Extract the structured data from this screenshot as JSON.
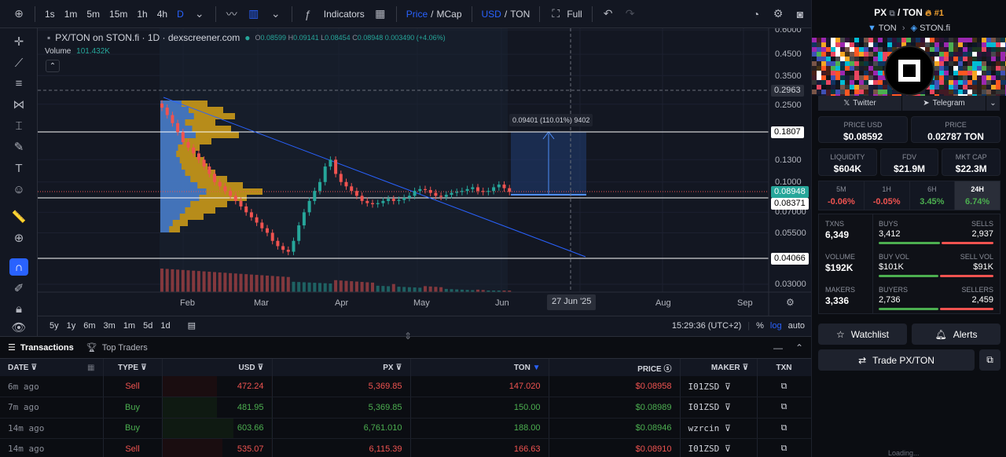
{
  "toolbar": {
    "timeframes": [
      "1s",
      "1m",
      "5m",
      "15m",
      "1h",
      "4h",
      "D"
    ],
    "active_timeframe": "D",
    "indicators_label": "Indicators",
    "price_label": "Price",
    "mcap_label": "MCap",
    "usd_label": "USD",
    "ton_label": "TON",
    "full_label": "Full"
  },
  "chart": {
    "pair_title": "PX/TON on STON.fi · 1D · dexscreener.com",
    "ohlc": {
      "o": "0.08599",
      "h": "0.09141",
      "l": "0.08454",
      "c": "0.08948",
      "change": "0.003490 (+4.06%)"
    },
    "volume_label": "Volume",
    "volume_value": "101.432K",
    "y_axis_labels": [
      "0.6000",
      "0.4500",
      "0.3500",
      "0.2500",
      "0.1300",
      "0.1000",
      "0.07000",
      "0.05500",
      "0.03000"
    ],
    "y_tags": {
      "crosshair": "0.2963",
      "line_upper": "0.1807",
      "last_price": "0.08948",
      "line_mid": "0.08371",
      "line_lower": "0.04066"
    },
    "x_axis_labels": [
      "Feb",
      "Mar",
      "Apr",
      "May",
      "Jun",
      "Aug",
      "Sep"
    ],
    "x_crosshair_tag": "27 Jun '25",
    "measure_text": "0.09401 (110.01%) 9402"
  },
  "chart_data": {
    "type": "candlestick",
    "series": [
      {
        "name": "price",
        "values": [
          0.24,
          0.22,
          0.2,
          0.18,
          0.16,
          0.15,
          0.14,
          0.13,
          0.12,
          0.11,
          0.1,
          0.095,
          0.09,
          0.085,
          0.08,
          0.075,
          0.07,
          0.066,
          0.062,
          0.058,
          0.055,
          0.05,
          0.047,
          0.045,
          0.044,
          0.05,
          0.06,
          0.07,
          0.08,
          0.09,
          0.1,
          0.12,
          0.13,
          0.11,
          0.1,
          0.095,
          0.09,
          0.085,
          0.08,
          0.078,
          0.077,
          0.078,
          0.08,
          0.082,
          0.08,
          0.081,
          0.083,
          0.085,
          0.09,
          0.092,
          0.091,
          0.088,
          0.085,
          0.084,
          0.086,
          0.088,
          0.089,
          0.09,
          0.092,
          0.094,
          0.09,
          0.089,
          0.09,
          0.094,
          0.097,
          0.093,
          0.089
        ]
      }
    ]
  },
  "bottom_bar": {
    "ranges": [
      "5y",
      "1y",
      "6m",
      "3m",
      "1m",
      "5d",
      "1d"
    ],
    "clock": "15:29:36 (UTC+2)",
    "percent_label": "%",
    "log_label": "log",
    "auto_label": "auto"
  },
  "transactions": {
    "tabs": {
      "transactions": "Transactions",
      "top_traders": "Top Traders"
    },
    "columns": [
      "DATE",
      "TYPE",
      "USD",
      "PX",
      "TON",
      "PRICE",
      "MAKER",
      "TXN"
    ],
    "rows": [
      {
        "age": "6m ago",
        "type": "Sell",
        "usd": "472.24",
        "px": "5,369.85",
        "ton": "147.020",
        "price": "$0.08958",
        "maker": "I01ZSD"
      },
      {
        "age": "7m ago",
        "type": "Buy",
        "usd": "481.95",
        "px": "5,369.85",
        "ton": "150.00",
        "price": "$0.08989",
        "maker": "I01ZSD"
      },
      {
        "age": "14m ago",
        "type": "Buy",
        "usd": "603.66",
        "px": "6,761.010",
        "ton": "188.00",
        "price": "$0.08946",
        "maker": "wzrcin"
      },
      {
        "age": "14m ago",
        "type": "Sell",
        "usd": "535.07",
        "px": "6,115.39",
        "ton": "166.63",
        "price": "$0.08910",
        "maker": "I01ZSD"
      }
    ]
  },
  "right_panel": {
    "pair": "PX",
    "quote": "TON",
    "rank": "#1",
    "chain": "TON",
    "dex": "STON.fi",
    "twitter": "Twitter",
    "telegram": "Telegram",
    "price_usd_label": "PRICE USD",
    "price_usd": "$0.08592",
    "price_label": "PRICE",
    "price_ton": "0.02787 TON",
    "liquidity_label": "LIQUIDITY",
    "liquidity": "$604K",
    "fdv_label": "FDV",
    "fdv": "$21.9M",
    "mcap_label": "MKT CAP",
    "mcap": "$22.3M",
    "timeframes": [
      {
        "label": "5M",
        "value": "-0.06%",
        "dir": "neg"
      },
      {
        "label": "1H",
        "value": "-0.05%",
        "dir": "neg"
      },
      {
        "label": "6H",
        "value": "3.45%",
        "dir": "pos"
      },
      {
        "label": "24H",
        "value": "6.74%",
        "dir": "pos"
      }
    ],
    "stats": {
      "txns_label": "TXNS",
      "txns": "6,349",
      "buys_label": "BUYS",
      "buys": "3,412",
      "sells_label": "SELLS",
      "sells": "2,937",
      "volume_label": "VOLUME",
      "volume": "$192K",
      "buy_vol_label": "BUY VOL",
      "buy_vol": "$101K",
      "sell_vol_label": "SELL VOL",
      "sell_vol": "$91K",
      "makers_label": "MAKERS",
      "makers": "3,336",
      "buyers_label": "BUYERS",
      "buyers": "2,736",
      "sellers_label": "SELLERS",
      "sellers": "2,459"
    },
    "watchlist": "Watchlist",
    "alerts": "Alerts",
    "trade": "Trade PX/TON",
    "loading": "Loading..."
  },
  "colors": {
    "accent": "#2962ff",
    "up": "#26a69a",
    "down": "#ef5350",
    "buy": "#4caf50",
    "volume_profile": "#d4a017"
  }
}
